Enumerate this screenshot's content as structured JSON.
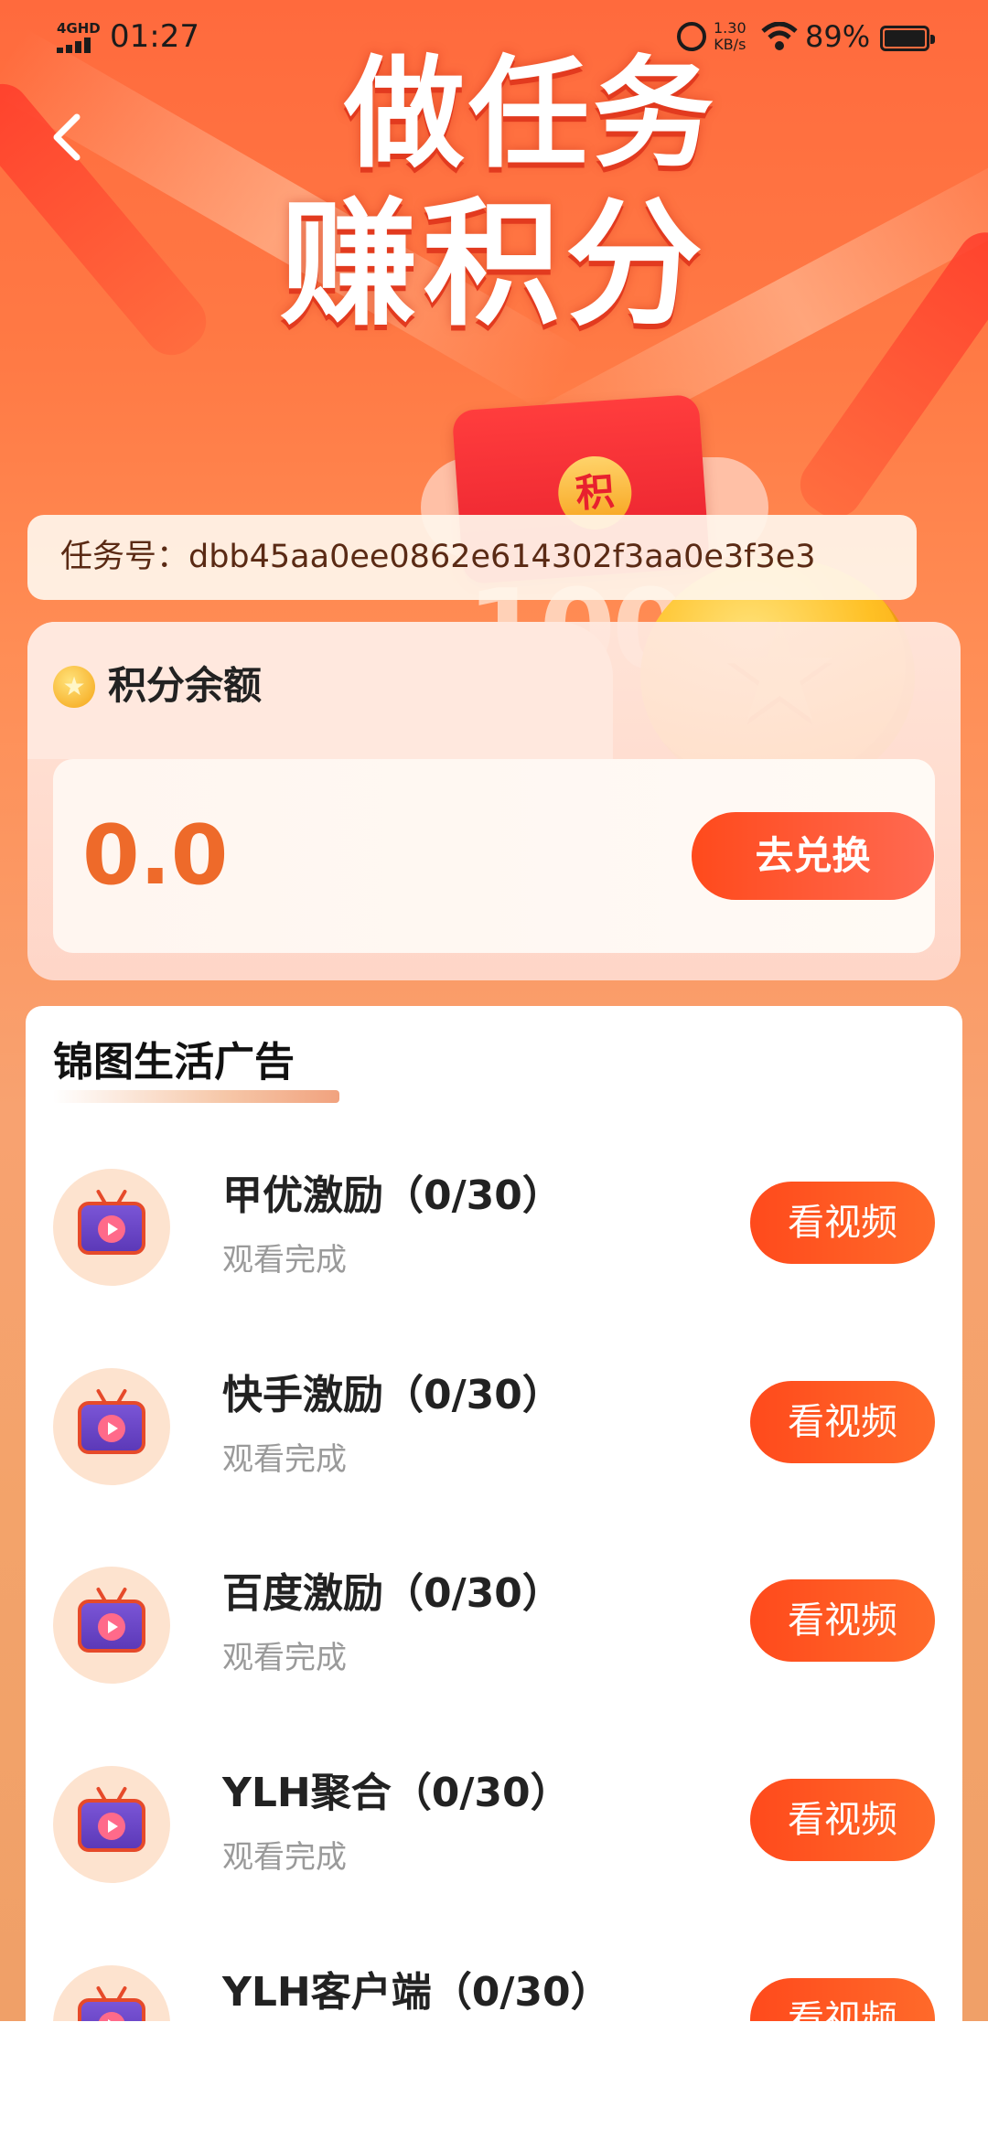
{
  "status_bar": {
    "network": "4GHD",
    "time": "01:27",
    "speed_value": "1.30",
    "speed_unit": "KB/s",
    "battery": "89%"
  },
  "hero": {
    "line1": "做任务",
    "line2": "赚积分",
    "envelope_seal": "积",
    "big_number": "100"
  },
  "task_id": {
    "text": "任务号：dbb45aa0ee0862e614302f3aa0e3f3e3"
  },
  "points": {
    "title": "积分余额",
    "value": "0.0",
    "redeem_label": "去兑换"
  },
  "ads": {
    "title": "锦图生活广告",
    "items": [
      {
        "name": "甲优激励（0/30）",
        "status": "观看完成",
        "button": "看视频"
      },
      {
        "name": "快手激励（0/30）",
        "status": "观看完成",
        "button": "看视频"
      },
      {
        "name": "百度激励（0/30）",
        "status": "观看完成",
        "button": "看视频"
      },
      {
        "name": "YLH聚合（0/30）",
        "status": "观看完成",
        "button": "看视频"
      },
      {
        "name": "YLH客户端（0/30）",
        "status": "",
        "button": "看视频"
      }
    ]
  },
  "colors": {
    "accent": "#ff4a1c",
    "points_value": "#ee6a2a",
    "background_top": "#ff6a3d"
  }
}
